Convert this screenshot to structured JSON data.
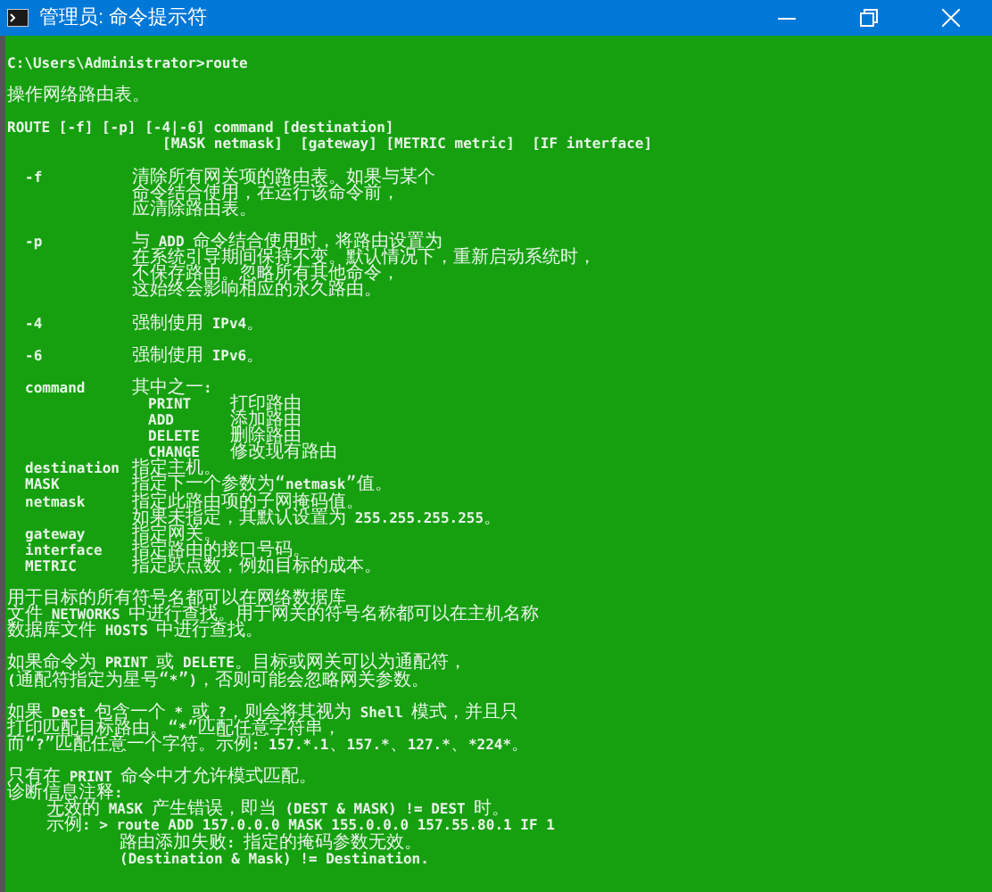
{
  "window": {
    "title": "管理员: 命令提示符"
  },
  "console": {
    "lines": [
      {
        "kind": "text",
        "text": "C:\\Users\\Administrator>route"
      },
      {
        "kind": "blank"
      },
      {
        "kind": "text",
        "text": "操作网络路由表。"
      },
      {
        "kind": "blank"
      },
      {
        "kind": "text",
        "text": "ROUTE [-f] [-p] [-4|-6] command [destination]"
      },
      {
        "kind": "continuation",
        "text": "[MASK netmask]  [gateway] [METRIC metric]  [IF interface]"
      },
      {
        "kind": "blank"
      },
      {
        "kind": "option",
        "name": "-f",
        "lines": [
          "清除所有网关项的路由表。如果与某个",
          "命令结合使用，在运行该命令前，",
          "应清除路由表。"
        ]
      },
      {
        "kind": "blank"
      },
      {
        "kind": "option",
        "name": "-p",
        "lines": [
          "与 ADD 命令结合使用时，将路由设置为",
          "在系统引导期间保持不变。默认情况下，重新启动系统时，",
          "不保存路由。忽略所有其他命令，",
          "这始终会影响相应的永久路由。"
        ]
      },
      {
        "kind": "blank"
      },
      {
        "kind": "option",
        "name": "-4",
        "lines": [
          "强制使用 IPv4。"
        ]
      },
      {
        "kind": "blank"
      },
      {
        "kind": "option",
        "name": "-6",
        "lines": [
          "强制使用 IPv6。"
        ]
      },
      {
        "kind": "blank"
      },
      {
        "kind": "option",
        "name": "command",
        "lines": [
          "其中之一:"
        ],
        "subcommands": [
          {
            "name": "PRINT",
            "text": "打印路由"
          },
          {
            "name": "ADD",
            "text": "添加路由"
          },
          {
            "name": "DELETE",
            "text": "删除路由"
          },
          {
            "name": "CHANGE",
            "text": "修改现有路由"
          }
        ]
      },
      {
        "kind": "option",
        "name": "destination",
        "lines": [
          "指定主机。"
        ]
      },
      {
        "kind": "option",
        "name": "MASK",
        "lines": [
          "指定下一个参数为“netmask”值。"
        ]
      },
      {
        "kind": "option",
        "name": "netmask",
        "lines": [
          "指定此路由项的子网掩码值。",
          "如果未指定，其默认设置为 255.255.255.255。"
        ]
      },
      {
        "kind": "option",
        "name": "gateway",
        "lines": [
          "指定网关。"
        ]
      },
      {
        "kind": "option",
        "name": "interface",
        "lines": [
          "指定路由的接口号码。"
        ]
      },
      {
        "kind": "option",
        "name": "METRIC",
        "lines": [
          "指定跃点数，例如目标的成本。"
        ]
      },
      {
        "kind": "blank"
      },
      {
        "kind": "text",
        "text": "用于目标的所有符号名都可以在网络数据库"
      },
      {
        "kind": "text",
        "text": "文件 NETWORKS 中进行查找。用于网关的符号名称都可以在主机名称"
      },
      {
        "kind": "text",
        "text": "数据库文件 HOSTS 中进行查找。"
      },
      {
        "kind": "blank"
      },
      {
        "kind": "text",
        "text": "如果命令为 PRINT 或 DELETE。目标或网关可以为通配符，"
      },
      {
        "kind": "text",
        "text": "(通配符指定为星号“*”)，否则可能会忽略网关参数。"
      },
      {
        "kind": "blank"
      },
      {
        "kind": "text",
        "text": "如果 Dest 包含一个 * 或 ?，则会将其视为 Shell 模式，并且只"
      },
      {
        "kind": "text",
        "text": "打印匹配目标路由。“*”匹配任意字符串，"
      },
      {
        "kind": "text",
        "text": "而“?”匹配任意一个字符。示例: 157.*.1、157.*、127.*、*224*。"
      },
      {
        "kind": "blank"
      },
      {
        "kind": "text",
        "text": "只有在 PRINT 命令中才允许模式匹配。"
      },
      {
        "kind": "text",
        "text": "诊断信息注释:",
        "children": [
          {
            "text": "无效的 MASK 产生错误，即当 (DEST & MASK) != DEST 时。"
          },
          {
            "text": "示例: > route ADD 157.0.0.0 MASK 155.0.0.0 157.55.80.1 IF 1",
            "children": [
              {
                "text": "路由添加失败: 指定的掩码参数无效。"
              },
              {
                "text": "(Destination & Mask) != Destination."
              }
            ]
          }
        ]
      }
    ]
  }
}
